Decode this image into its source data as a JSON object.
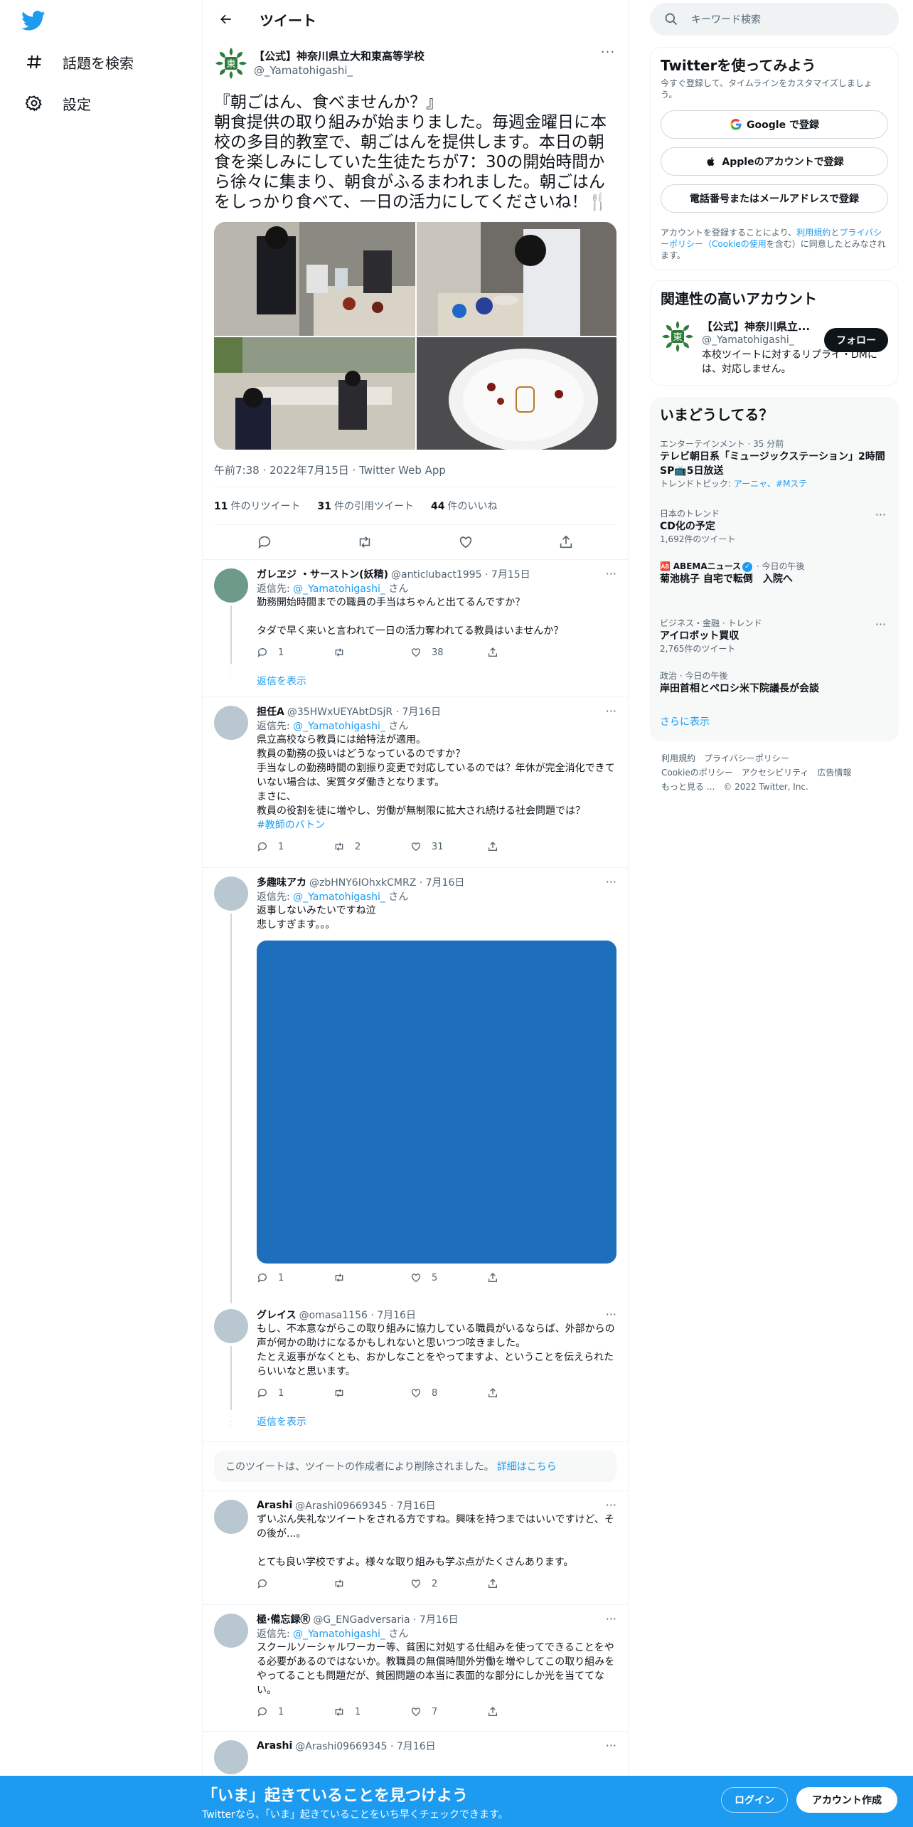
{
  "nav": {
    "explore_label": "話題を検索",
    "settings_label": "設定"
  },
  "header": {
    "title": "ツイート"
  },
  "main_tweet": {
    "author_name": "【公式】神奈川県立大和東高等学校",
    "author_handle": "@_Yamatohigashi_",
    "text": "『朝ごはん、食べませんか？』\n朝食提供の取り組みが始まりました。毎週金曜日に本校の多目的教室で、朝ごはんを提供します。本日の朝食を楽しみにしていた生徒たちが7：30の開始時間から徐々に集まり、朝食がふるまわれました。朝ごはんをしっかり食べて、一日の活力にしてくださいね！🍴",
    "meta": "午前7:38 · 2022年7月15日 · Twitter Web App",
    "retweets_count": "11",
    "retweets_label": "件のリツイート",
    "quotes_count": "31",
    "quotes_label": "件の引用ツイート",
    "likes_count": "44",
    "likes_label": "件のいいね"
  },
  "replies": [
    {
      "name": "ガレヱジ ・サーストン(妖精)",
      "handle": "@anticlubact1995 · 7月15日",
      "reply_prefix": "返信先: ",
      "reply_to": "@_Yamatohigashi_",
      "reply_suffix": " さん",
      "text": "勤務開始時間までの職員の手当はちゃんと出てるんですか？\n\nタダで早く来いと言われて一日の活力奪われてる教員はいませんか？",
      "replies": "1",
      "retweets": "",
      "likes": "38",
      "show_replies": "返信を表示"
    },
    {
      "name": "担任A",
      "handle": "@35HWxUEYAbtDSjR · 7月16日",
      "reply_prefix": "返信先: ",
      "reply_to": "@_Yamatohigashi_",
      "reply_suffix": " さん",
      "text": "県立高校なら教員には給特法が適用。\n教員の勤務の扱いはどうなっているのですか？\n手当なしの勤務時間の割振り変更で対応しているのでは？年休が完全消化できていない場合は、実質タダ働きとなります。\nまさに、\n教員の役割を徒に増やし、労働が無制限に拡大され続ける社会問題では？",
      "hashtag": "#教師のバトン",
      "replies": "1",
      "retweets": "2",
      "likes": "31"
    },
    {
      "name": "多趣味アカ",
      "handle": "@zbHNY6IOhxkCMRZ · 7月16日",
      "reply_prefix": "返信先: ",
      "reply_to": "@_Yamatohigashi_",
      "reply_suffix": " さん",
      "text": "返事しないみたいですね泣\n悲しすぎます。。。",
      "replies": "1",
      "retweets": "",
      "likes": "5"
    },
    {
      "name": "グレイス",
      "handle": "@omasa1156 · 7月16日",
      "text": "もし、不本意ながらこの取り組みに協力している職員がいるならば、外部からの声が何かの助けになるかもしれないと思いつつ呟きました。\nたとえ返事がなくとも、おかしなことをやってますよ、ということを伝えられたらいいなと思います。",
      "replies": "1",
      "retweets": "",
      "likes": "8",
      "show_replies": "返信を表示"
    },
    {
      "name": "Arashi",
      "handle": "@Arashi09669345 · 7月16日",
      "text": "ずいぶん失礼なツイートをされる方ですね。興味を持つまではいいですけど、その後が...。\n\nとても良い学校ですよ。様々な取り組みも学ぶ点がたくさんあります。",
      "replies": "",
      "retweets": "",
      "likes": "2"
    },
    {
      "name": "極·備忘録Ⓡ",
      "handle": "@G_ENGadversaria · 7月16日",
      "reply_prefix": "返信先: ",
      "reply_to": "@_Yamatohigashi_",
      "reply_suffix": " さん",
      "text": "スクールソーシャルワーカー等、貧困に対処する仕組みを使ってできることをやる必要があるのではないか。教職員の無償時間外労働を増やしてこの取り組みをやってることも問題だが、貧困問題の本当に表面的な部分にしか光を当ててない。",
      "replies": "1",
      "retweets": "1",
      "likes": "7"
    },
    {
      "name": "Arashi",
      "handle": "@Arashi09669345 · 7月16日"
    }
  ],
  "deleted_notice": {
    "text": "このツイートは、ツイートの作成者により削除されました。",
    "link": "詳細はこちら"
  },
  "sidebar": {
    "search_placeholder": "キーワード検索",
    "signup": {
      "title": "Twitterを使ってみよう",
      "subtitle": "今すぐ登録して、タイムラインをカスタマイズしましょう。",
      "google_label": "Google で登録",
      "apple_label": "Appleのアカウントで登録",
      "phone_label": "電話番号またはメールアドレスで登録",
      "legal_prefix": "アカウントを登録することにより、",
      "legal_link1": "利用規約",
      "legal_mid": "と",
      "legal_link2": "プライバシーポリシー（Cookieの使用",
      "legal_suffix": "を含む）に同意したとみなされます。"
    },
    "related": {
      "title": "関連性の高いアカウント",
      "name": "【公式】神奈川県立...",
      "handle": "@_Yamatohigashi_",
      "bio": "本校ツイートに対するリプライ・DMには、対応しません。",
      "follow_label": "フォロー"
    },
    "trends": {
      "title": "いまどうしてる？",
      "items": [
        {
          "context": "エンターテインメント · 35 分前",
          "name": "テレビ朝日系「ミュージックステーション」2時間SP📺5日放送",
          "topic_prefix": "トレンドトピック: ",
          "topic_links": "アーニャ、#Mステ"
        },
        {
          "context": "日本のトレンド",
          "name": "CD化の予定",
          "count": "1,692件のツイート"
        },
        {
          "context_prefix": "ABEMAニュース",
          "context_suffix": " · 今日の午後",
          "name": "菊池桃子 自宅で転倒　入院へ"
        },
        {
          "context": "ビジネス・金融 · トレンド",
          "name": "アイロボット買収",
          "count": "2,765件のツイート"
        },
        {
          "context": "政治 · 今日の午後",
          "name": "岸田首相とペロシ米下院議長が会談"
        }
      ],
      "show_more": "さらに表示"
    },
    "footer": {
      "links": [
        "利用規約",
        "プライバシーポリシー",
        "Cookieのポリシー",
        "アクセシビリティ",
        "広告情報",
        "もっと見る ..."
      ],
      "copyright": "© 2022 Twitter, Inc."
    }
  },
  "bottom_bar": {
    "title": "「いま」起きていることを見つけよう",
    "subtitle": "Twitterなら、「いま」起きていることをいち早くチェックできます。",
    "login_label": "ログイン",
    "signup_label": "アカウント作成"
  },
  "colors": {
    "accent": "#1d9bf0",
    "bottom_bar": "#1d9bf0",
    "media_placeholder": "#1d6fbb",
    "school_logo": "#2f7d3a"
  }
}
